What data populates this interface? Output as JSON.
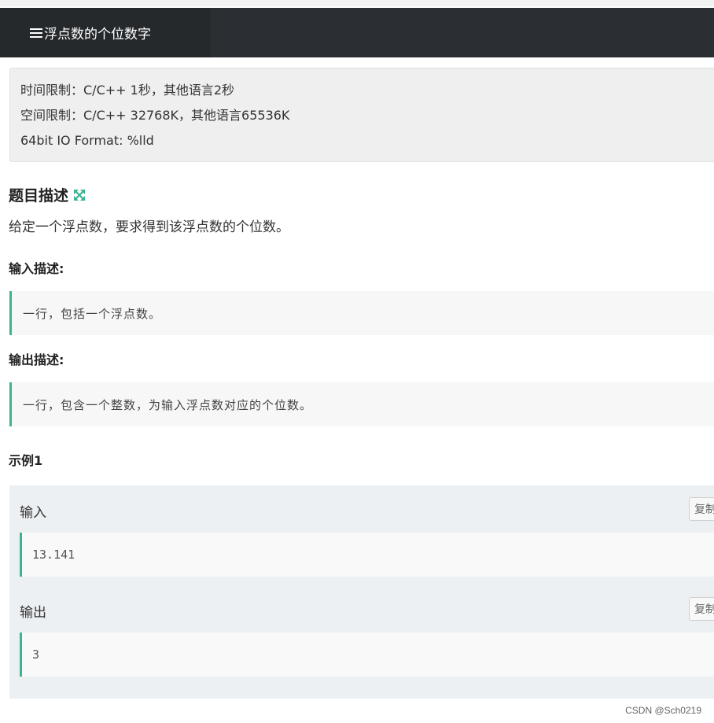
{
  "header": {
    "tab_title": "浮点数的个位数字"
  },
  "limits": {
    "time": "时间限制：C/C++ 1秒，其他语言2秒",
    "space": "空间限制：C/C++ 32768K，其他语言65536K",
    "io_format": "64bit IO Format: %lld"
  },
  "problem": {
    "description_title": "题目描述",
    "description": "给定一个浮点数，要求得到该浮点数的个位数。",
    "input_title": "输入描述:",
    "input_desc": "一行，包括一个浮点数。",
    "output_title": "输出描述:",
    "output_desc": "一行，包含一个整数，为输入浮点数对应的个位数。"
  },
  "example": {
    "title": "示例1",
    "input_label": "输入",
    "input_value": "13.141",
    "output_label": "输出",
    "output_value": "3",
    "copy_label": "复制"
  },
  "watermark": "CSDN @Sch0219",
  "colors": {
    "header_bg": "#2b2f33",
    "accent": "#3bb491"
  }
}
